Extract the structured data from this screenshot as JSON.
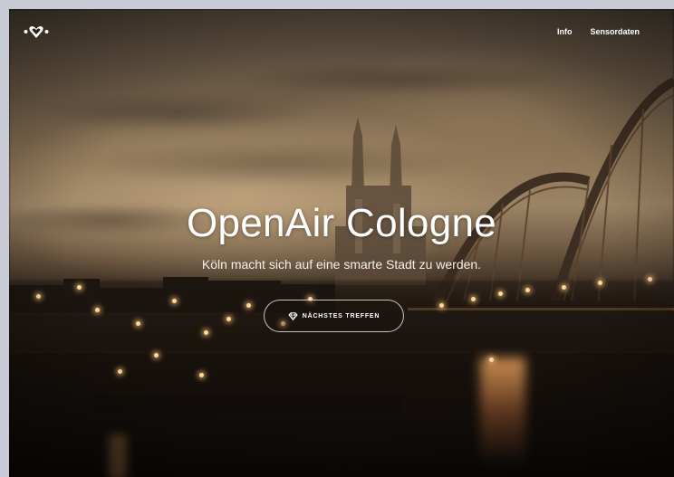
{
  "brand": {
    "logo_icon": "heart-shield-logo-icon"
  },
  "nav": {
    "items": [
      {
        "label": "Info"
      },
      {
        "label": "Sensordaten"
      }
    ]
  },
  "hero": {
    "title": "OpenAir Cologne",
    "subtitle": "Köln macht sich auf eine smarte Stadt zu werden.",
    "cta": {
      "label": "NÄCHSTES TREFFEN",
      "icon": "diamond-icon"
    }
  },
  "colors": {
    "text": "#ffffff",
    "overlay_tint": "#8c7457"
  }
}
